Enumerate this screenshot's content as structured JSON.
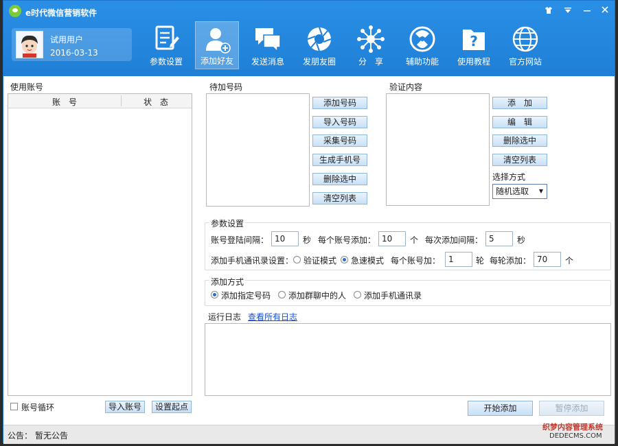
{
  "window": {
    "title": "e时代微信营销软件",
    "controls": [
      "▾",
      "—",
      "✕"
    ]
  },
  "user": {
    "name": "试用用户",
    "date": "2016-03-13"
  },
  "nav": [
    {
      "label": "参数设置",
      "icon": "settings-document-icon"
    },
    {
      "label": "添加好友",
      "icon": "add-friend-icon",
      "active": true
    },
    {
      "label": "发送消息",
      "icon": "message-icon"
    },
    {
      "label": "发朋友圈",
      "icon": "camera-shutter-icon"
    },
    {
      "label": "分　享",
      "icon": "share-icon"
    },
    {
      "label": "辅助功能",
      "icon": "helper-icon"
    },
    {
      "label": "使用教程",
      "icon": "tutorial-icon"
    },
    {
      "label": "官方网站",
      "icon": "globe-icon"
    }
  ],
  "accounts": {
    "title": "使用账号",
    "columns": [
      "账　号",
      "状　态"
    ],
    "loop_label": "账号循环",
    "import_button": "导入账号",
    "set_start_button": "设置起点"
  },
  "pending": {
    "title": "待加号码",
    "buttons": [
      "添加号码",
      "导入号码",
      "采集号码",
      "生成手机号",
      "删除选中",
      "清空列表"
    ]
  },
  "verify": {
    "title": "验证内容",
    "buttons": [
      "添　加",
      "编　辑",
      "删除选中",
      "清空列表"
    ],
    "select_label": "选择方式",
    "select_value": "随机选取"
  },
  "params": {
    "title": "参数设置",
    "login_interval_label": "账号登陆间隔：",
    "login_interval_value": "10",
    "unit_sec": "秒",
    "per_account_label": "每个账号添加：",
    "per_account_value": "10",
    "unit_count": "个",
    "each_interval_label": "每次添加间隔：",
    "each_interval_value": "5",
    "contacts_label": "添加手机通讯录设置：",
    "mode_verify": "验证模式",
    "mode_fast": "急速模式",
    "selected_mode": "急速模式",
    "per_account_rounds_label": "每个账号加：",
    "per_account_rounds_value": "1",
    "unit_round": "轮",
    "per_round_label": "每轮添加：",
    "per_round_value": "70"
  },
  "add_method": {
    "title": "添加方式",
    "options": [
      "添加指定号码",
      "添加群聊中的人",
      "添加手机通讯录"
    ],
    "selected": "添加指定号码"
  },
  "log": {
    "title": "运行日志",
    "view_all": "查看所有日志"
  },
  "actions": {
    "start": "开始添加",
    "pause": "暂停添加"
  },
  "status": {
    "label": "公告：",
    "value": "暂无公告"
  },
  "watermark": {
    "line1": "织梦内容管理系统",
    "line2": "DEDECMS.COM"
  },
  "colors": {
    "titlebar": "#1f7fd6",
    "button_border": "#8fb6db",
    "link": "#1a4fd0"
  }
}
